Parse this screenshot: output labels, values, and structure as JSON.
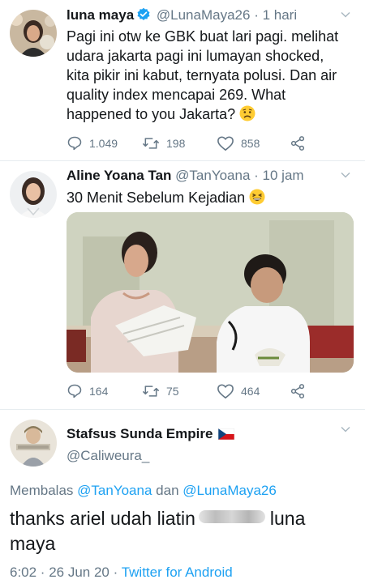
{
  "tweets": [
    {
      "name": "luna maya",
      "handle": "@LunaMaya26",
      "time": "· 1 hari",
      "text_lines": [
        "Pagi ini otw ke GBK buat lari pagi. melihat",
        "udara jakarta pagi ini lumayan shocked,",
        "kita pikir ini kabut, ternyata polusi. Dan air",
        "quality index mencapai 269. What",
        "happened to you Jakarta?"
      ],
      "emoji": "worried-face-emoji",
      "replies": "1.049",
      "retweets": "198",
      "likes": "858"
    },
    {
      "name": "Aline Yoana Tan",
      "handle": "@TanYoana",
      "time": "· 10 jam",
      "text": "30 Menit Sebelum Kejadian",
      "emoji": "grinning-squint-emoji",
      "replies": "164",
      "retweets": "75",
      "likes": "464"
    }
  ],
  "reply": {
    "name": "Stafsus Sunda Empire",
    "flag": "czech-flag-icon",
    "handle": "@Caliweura_",
    "replying_prefix": "Membalas",
    "replying_to_1": "@TanYoana",
    "replying_and": "dan",
    "replying_to_2": "@LunaMaya26",
    "text_1": "thanks ariel udah liatin",
    "text_2": "luna",
    "text_3": "maya",
    "meta_time": "6:02 · 26 Jun 20 ·",
    "meta_source": "Twitter for Android"
  },
  "colors": {
    "link": "#1da1f2",
    "muted": "#657786",
    "verified": "#1da1f2"
  }
}
